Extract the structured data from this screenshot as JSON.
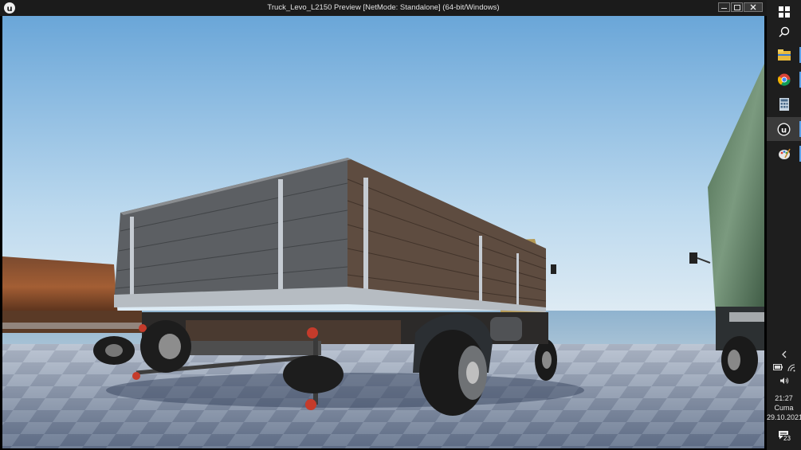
{
  "window": {
    "title": "Truck_Levo_L2150 Preview [NetMode: Standalone]  (64-bit/Windows)",
    "app_icon": "unreal-engine-icon",
    "controls": [
      "minimize-icon",
      "maximize-icon",
      "close-icon"
    ]
  },
  "scene": {
    "description_icons": "game-viewport",
    "sky_top": "#6aa6d8",
    "sky_bottom": "#d4e8f4",
    "floor_light": "#a9b6c9",
    "floor_dark": "#6c7a93"
  },
  "taskbar": {
    "pinned": [
      {
        "name": "windows-start-icon"
      },
      {
        "name": "search-icon"
      },
      {
        "name": "file-explorer-icon"
      },
      {
        "name": "chrome-icon"
      },
      {
        "name": "calculator-icon"
      },
      {
        "name": "unreal-engine-icon"
      },
      {
        "name": "paint-icon"
      }
    ],
    "tray": {
      "time": "21:27",
      "day": "Cuma",
      "date": "29.10.2021",
      "notifications": "23"
    }
  }
}
